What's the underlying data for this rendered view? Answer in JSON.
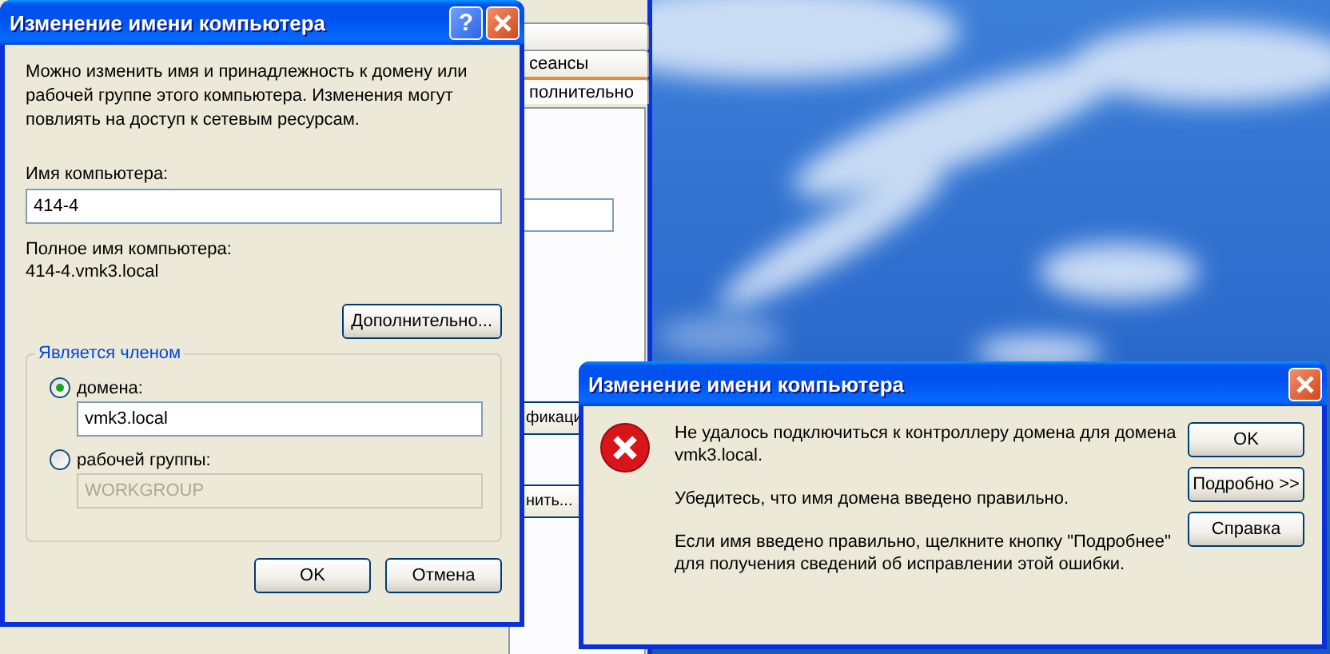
{
  "background_window": {
    "tabs": [
      {
        "label": "сеансы",
        "selected": false
      },
      {
        "label": "полнительно",
        "selected": true
      }
    ],
    "buttons": [
      "фикаци",
      "нить..."
    ]
  },
  "rename_dialog": {
    "title": "Изменение имени компьютера",
    "help_button": "?",
    "description": "Можно изменить имя и принадлежность к домену или рабочей группе этого компьютера. Изменения могут повлиять на доступ к сетевым ресурсам.",
    "computer_name": {
      "label": "Имя компьютера:",
      "value": "414-4"
    },
    "full_name": {
      "label": "Полное имя компьютера:",
      "value": "414-4.vmk3.local"
    },
    "more_button": "Дополнительно...",
    "membership": {
      "legend": "Является членом",
      "options": [
        {
          "label": "домена:",
          "selected": true,
          "disabled": false,
          "value": "vmk3.local"
        },
        {
          "label": "рабочей группы:",
          "selected": false,
          "disabled": true,
          "value": "WORKGROUP"
        }
      ]
    },
    "buttons": [
      "OK",
      "Отмена"
    ]
  },
  "error_dialog": {
    "title": "Изменение имени компьютера",
    "messages": [
      "Не удалось подключиться к контроллеру домена для домена vmk3.local.",
      "Убедитесь, что имя домена введено правильно.",
      "Если имя введено правильно, щелкните кнопку \"Подробнее\" для получения сведений об исправлении этой ошибки."
    ],
    "buttons": [
      "OK",
      "Подробно >>",
      "Справка"
    ]
  }
}
